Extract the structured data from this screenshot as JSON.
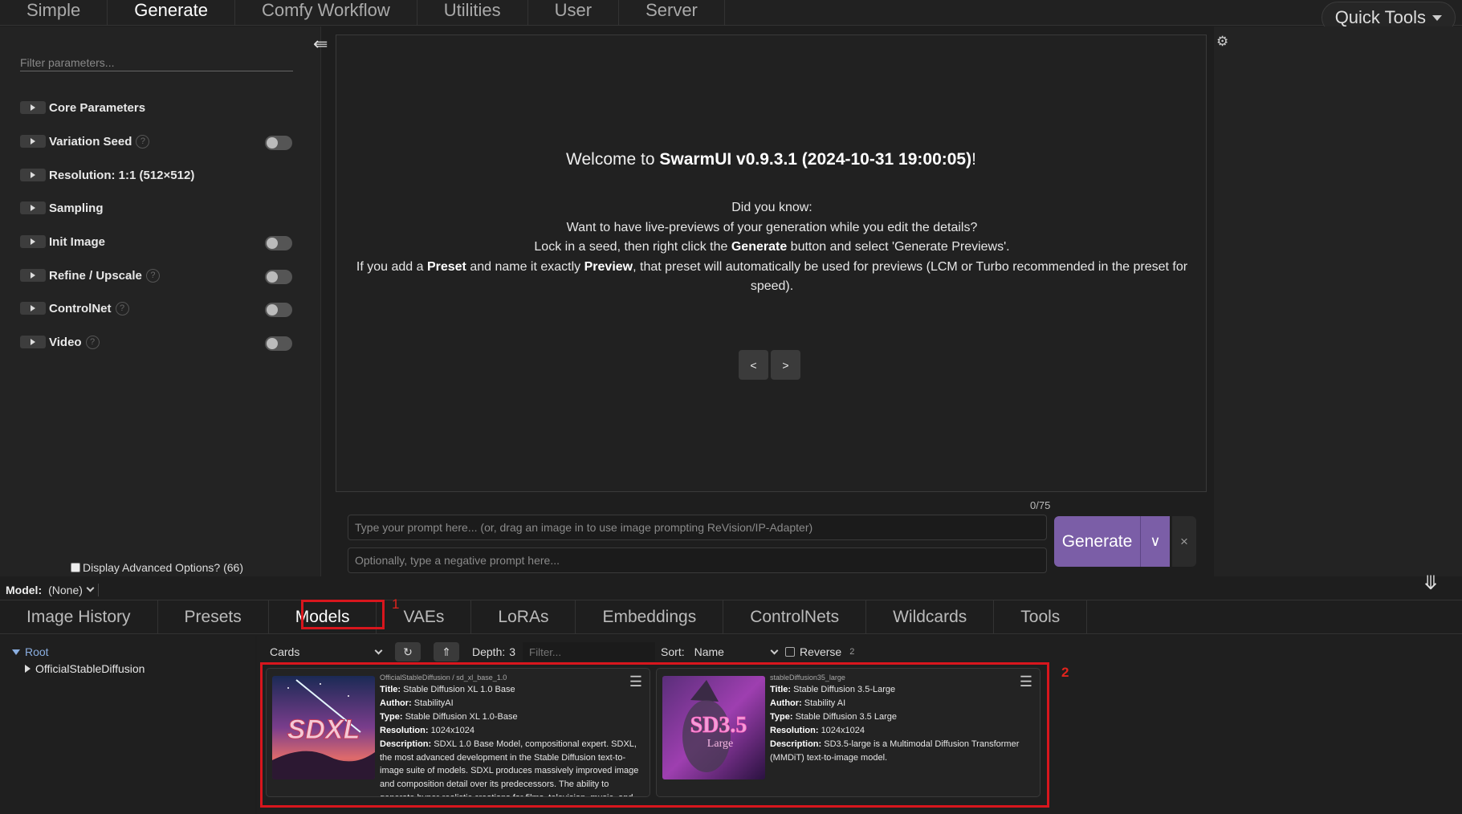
{
  "topnav": {
    "tabs": [
      "Simple",
      "Generate",
      "Comfy Workflow",
      "Utilities",
      "User",
      "Server"
    ],
    "active": "Generate",
    "quick_tools": "Quick Tools"
  },
  "params": {
    "filter_placeholder": "Filter parameters...",
    "groups": [
      {
        "label": "Core Parameters",
        "help": false,
        "toggle": false
      },
      {
        "label": "Variation Seed",
        "help": true,
        "toggle": true
      },
      {
        "label": "Resolution: 1:1 (512×512)",
        "help": false,
        "toggle": false
      },
      {
        "label": "Sampling",
        "help": false,
        "toggle": false
      },
      {
        "label": "Init Image",
        "help": false,
        "toggle": true
      },
      {
        "label": "Refine / Upscale",
        "help": true,
        "toggle": true
      },
      {
        "label": "ControlNet",
        "help": true,
        "toggle": true
      },
      {
        "label": "Video",
        "help": true,
        "toggle": true
      }
    ],
    "advanced_label": "Display Advanced Options? (66)"
  },
  "welcome": {
    "prefix": "Welcome to ",
    "name": "SwarmUI v0.9.3.1 (2024-10-31 19:00:05)",
    "suffix": "!",
    "did_you_know": "Did you know:",
    "line1": "Want to have live-previews of your generation while you edit the details?",
    "line2a": "Lock in a seed, then right click the ",
    "line2b": "Generate",
    "line2c": " button and select 'Generate Previews'.",
    "line3a": "If you add a ",
    "line3b": "Preset",
    "line3c": " and name it exactly ",
    "line3d": "Preview",
    "line3e": ", that preset will automatically be used for previews (LCM or Turbo recommended in the preset for speed).",
    "prev": "<",
    "next": ">"
  },
  "prompt": {
    "counter": "0/75",
    "placeholder": "Type your prompt here... (or, drag an image in to use image prompting ReVision/IP-Adapter)",
    "negative_placeholder": "Optionally, type a negative prompt here...",
    "generate": "Generate",
    "cancel": "×"
  },
  "model_bar": {
    "label": "Model:",
    "value": "(None)"
  },
  "bottom_tabs": {
    "tabs": [
      "Image History",
      "Presets",
      "Models",
      "VAEs",
      "LoRAs",
      "Embeddings",
      "ControlNets",
      "Wildcards",
      "Tools"
    ],
    "active": "Models"
  },
  "annotations": {
    "one": "1",
    "two": "2",
    "color": "#d8161d"
  },
  "tree": {
    "root": "Root",
    "child": "OfficialStableDiffusion"
  },
  "browser": {
    "view": "Cards",
    "depth_label": "Depth:",
    "depth_value": "3",
    "filter_placeholder": "Filter...",
    "sort_label": "Sort:",
    "sort_value": "Name",
    "reverse_label": "Reverse",
    "reverse_num": "2"
  },
  "cards": [
    {
      "path": "OfficialStableDiffusion / sd_xl_base_1.0",
      "title_label": "Title:",
      "title": "Stable Diffusion XL 1.0 Base",
      "author_label": "Author:",
      "author": "StabilityAI",
      "type_label": "Type:",
      "type": "Stable Diffusion XL 1.0-Base",
      "res_label": "Resolution:",
      "resolution": "1024x1024",
      "desc_label": "Description:",
      "description": "SDXL 1.0 Base Model, compositional expert. SDXL, the most advanced development in the Stable Diffusion text-to-image suite of models. SDXL produces massively improved image and composition detail over its predecessors. The ability to generate hyper-realistic creations for films, television, music, and",
      "thumb_text": "SDXL"
    },
    {
      "path": "stableDiffusion35_large",
      "title_label": "Title:",
      "title": "Stable Diffusion 3.5-Large",
      "author_label": "Author:",
      "author": "Stability AI",
      "type_label": "Type:",
      "type": "Stable Diffusion 3.5 Large",
      "res_label": "Resolution:",
      "resolution": "1024x1024",
      "desc_label": "Description:",
      "description": "SD3.5-large is a Multimodal Diffusion Transformer (MMDiT) text-to-image model.",
      "thumb_text": "SD3.5",
      "thumb_sub": "Large"
    }
  ]
}
